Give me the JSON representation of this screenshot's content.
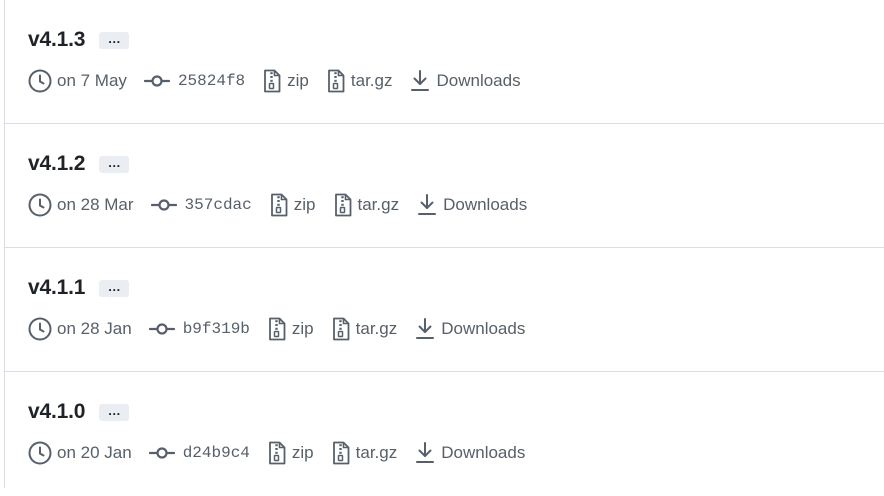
{
  "tags": [
    {
      "name": "v4.1.3",
      "more": "…",
      "date": "on 7 May",
      "commit": "25824f8",
      "zip": "zip",
      "targz": "tar.gz",
      "downloads": "Downloads"
    },
    {
      "name": "v4.1.2",
      "more": "…",
      "date": "on 28 Mar",
      "commit": "357cdac",
      "zip": "zip",
      "targz": "tar.gz",
      "downloads": "Downloads"
    },
    {
      "name": "v4.1.1",
      "more": "…",
      "date": "on 28 Jan",
      "commit": "b9f319b",
      "zip": "zip",
      "targz": "tar.gz",
      "downloads": "Downloads"
    },
    {
      "name": "v4.1.0",
      "more": "…",
      "date": "on 20 Jan",
      "commit": "d24b9c4",
      "zip": "zip",
      "targz": "tar.gz",
      "downloads": "Downloads"
    }
  ],
  "icons": {
    "date": "clock-icon",
    "commit": "git-commit-icon",
    "zip": "file-zip-icon",
    "targz": "file-zip-icon",
    "downloads": "download-icon"
  },
  "colors": {
    "text": "#1f2328",
    "muted": "#57606a",
    "border": "#d8dee4",
    "button_bg": "#eaeef2"
  }
}
